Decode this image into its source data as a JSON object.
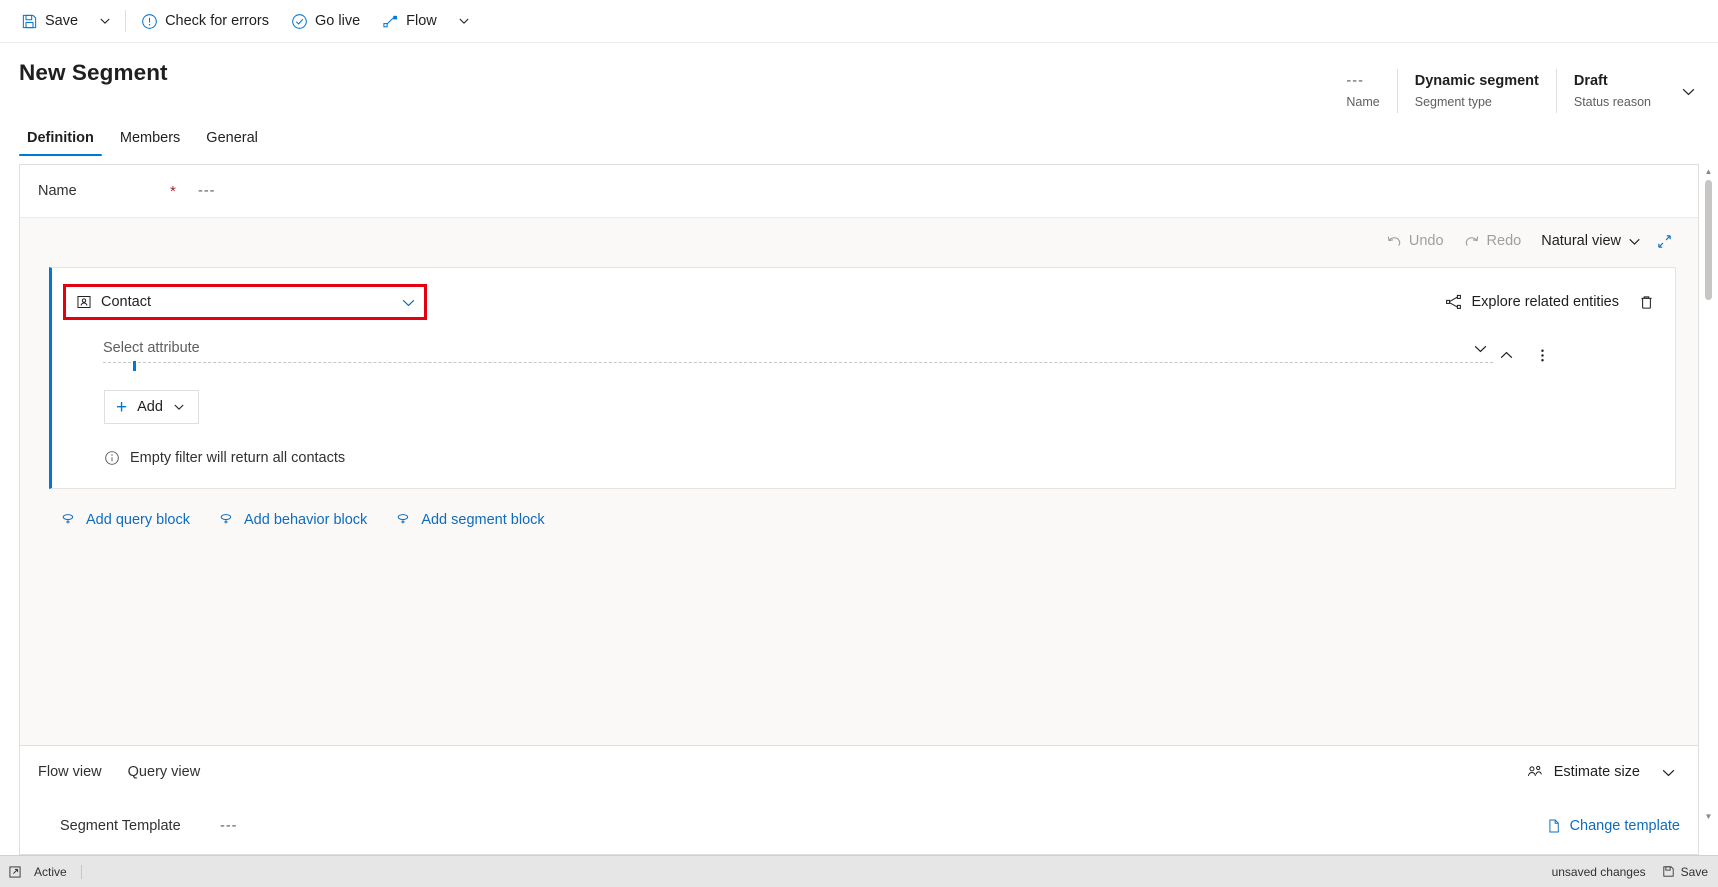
{
  "commandbar": {
    "items": [
      {
        "label": "Save",
        "icon": "save-icon"
      },
      {
        "label": "Check for errors",
        "icon": "error-circle-icon"
      },
      {
        "label": "Go live",
        "icon": "checkmark-circle-icon"
      },
      {
        "label": "Flow",
        "icon": "flow-icon"
      }
    ],
    "save_caret": "chevron-down-icon",
    "flow_caret": "chevron-down-icon"
  },
  "header": {
    "title": "New Segment",
    "info": [
      {
        "value": "---",
        "label": "Name",
        "muted": true
      },
      {
        "value": "Dynamic segment",
        "label": "Segment type",
        "muted": false
      },
      {
        "value": "Draft",
        "label": "Status reason",
        "muted": false
      }
    ],
    "expand_icon": "chevron-down-icon"
  },
  "tabs": [
    {
      "label": "Definition",
      "active": true
    },
    {
      "label": "Members",
      "active": false
    },
    {
      "label": "General",
      "active": false
    }
  ],
  "name_field": {
    "label": "Name",
    "required_marker": "*",
    "value": "---"
  },
  "builder_toolbar": {
    "undo": {
      "label": "Undo",
      "disabled": true
    },
    "redo": {
      "label": "Redo",
      "disabled": true
    },
    "view_mode": {
      "label": "Natural view",
      "caret": "chevron-down-icon"
    },
    "expand": "expand-diagonal-icon"
  },
  "query_block": {
    "entity": {
      "value": "Contact",
      "icon": "contact-icon",
      "caret": "chevron-down-icon",
      "highlighted": true
    },
    "explore_link": {
      "label": "Explore related entities",
      "icon": "share-network-icon"
    },
    "delete_icon": "trash-icon",
    "attribute": {
      "placeholder": "Select attribute",
      "caret": "chevron-down-icon"
    },
    "collapse_icon": "chevron-up-icon",
    "more_icon": "more-vertical-icon",
    "add_button": {
      "label": "Add",
      "plus": "+",
      "caret": "chevron-down-icon"
    },
    "info_message": {
      "text": "Empty filter will return all contacts",
      "icon": "info-circle-icon"
    }
  },
  "block_links": [
    {
      "label": "Add query block",
      "icon": "add-branch-icon"
    },
    {
      "label": "Add behavior block",
      "icon": "add-branch-icon"
    },
    {
      "label": "Add segment block",
      "icon": "add-branch-icon"
    }
  ],
  "bottom_panel": {
    "views": [
      {
        "label": "Flow view"
      },
      {
        "label": "Query view"
      }
    ],
    "estimate": {
      "label": "Estimate size",
      "icon": "people-icon",
      "caret": "chevron-down-icon"
    },
    "template": {
      "label": "Segment Template",
      "value": "---",
      "change_link": {
        "label": "Change template",
        "icon": "document-icon"
      }
    }
  },
  "statusbar": {
    "expand_icon": "popout-icon",
    "state": "Active",
    "unsaved": "unsaved changes",
    "save": {
      "label": "Save",
      "icon": "save-icon"
    }
  },
  "colors": {
    "accent": "#0078d4",
    "link": "#0f6cbd",
    "highlight": "#e3000f",
    "required": "#a4262c",
    "builder_bg": "#faf9f8",
    "statusbar_bg": "#e6e6e6"
  }
}
